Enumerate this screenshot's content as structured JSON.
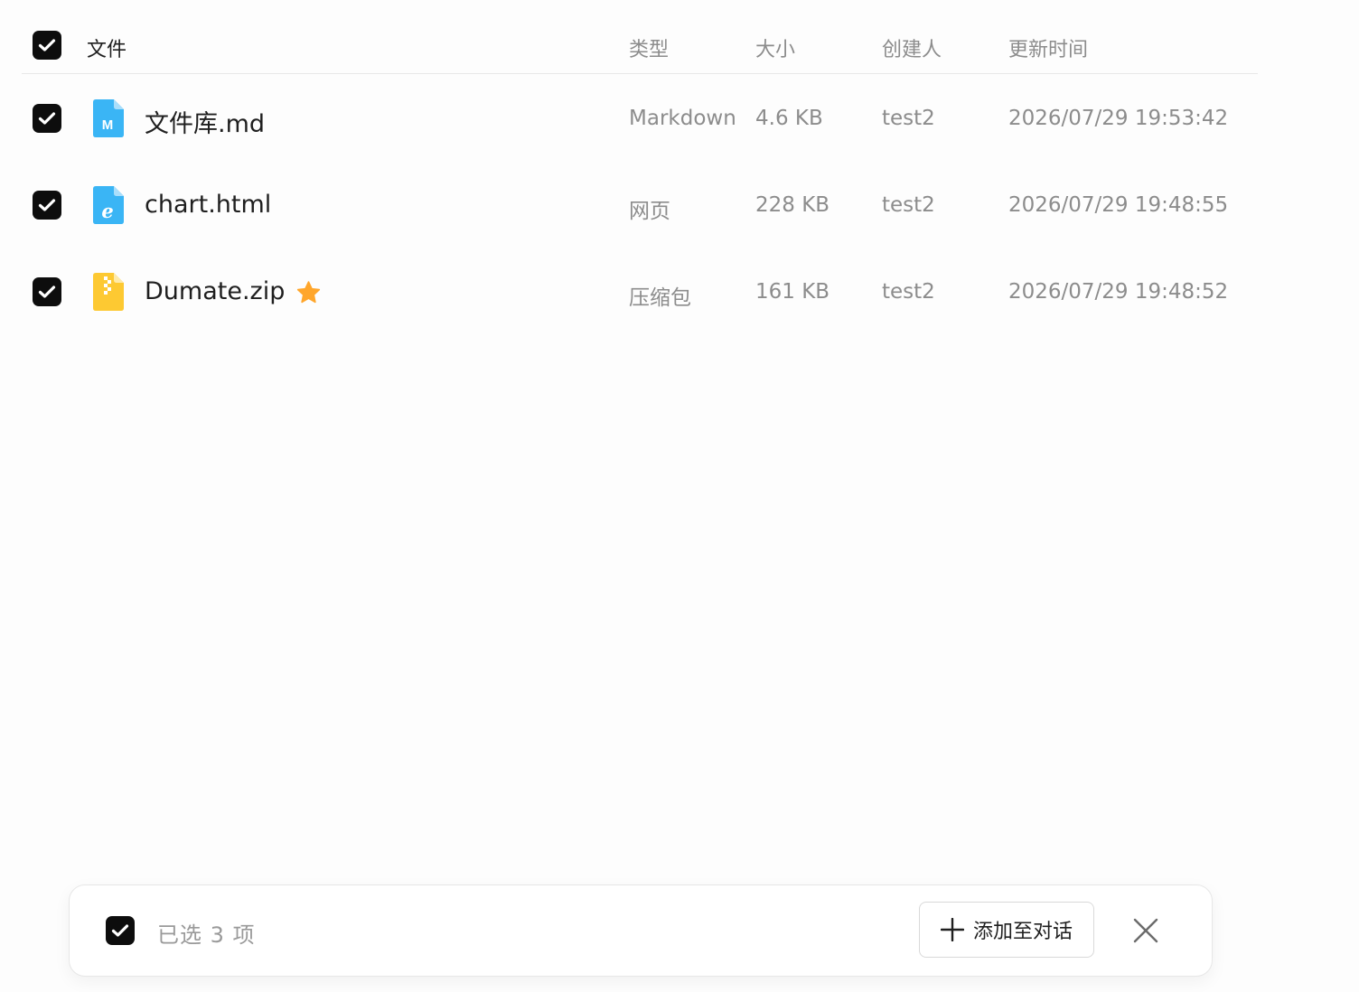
{
  "table": {
    "headers": {
      "name": "文件",
      "type": "类型",
      "size": "大小",
      "creator": "创建人",
      "updated": "更新时间"
    },
    "rows": [
      {
        "name": "文件库.md",
        "icon": "markdown-file-icon",
        "icon_glyph": "M",
        "icon_color": "#3ab5f5",
        "type": "Markdown",
        "size": "4.6 KB",
        "creator": "test2",
        "updated": "2026/07/29 19:53:42",
        "starred": false,
        "checked": true
      },
      {
        "name": "chart.html",
        "icon": "html-file-icon",
        "icon_glyph": "e",
        "icon_color": "#3ab5f5",
        "type": "网页",
        "size": "228 KB",
        "creator": "test2",
        "updated": "2026/07/29 19:48:55",
        "starred": false,
        "checked": true
      },
      {
        "name": "Dumate.zip",
        "icon": "zip-file-icon",
        "icon_glyph": "",
        "icon_color": "#fdc932",
        "type": "压缩包",
        "size": "161 KB",
        "creator": "test2",
        "updated": "2026/07/29 19:48:52",
        "starred": true,
        "checked": true
      }
    ]
  },
  "selection_bar": {
    "count_text": "已选 3 项",
    "add_label": "添加至对话",
    "add_icon": "plus-icon",
    "close_icon": "close-icon"
  },
  "colors": {
    "checkbox": "#0d0d0d",
    "star": "#ffa62b",
    "muted_text": "#8c8c8c",
    "primary_text": "#1f1f1f"
  }
}
